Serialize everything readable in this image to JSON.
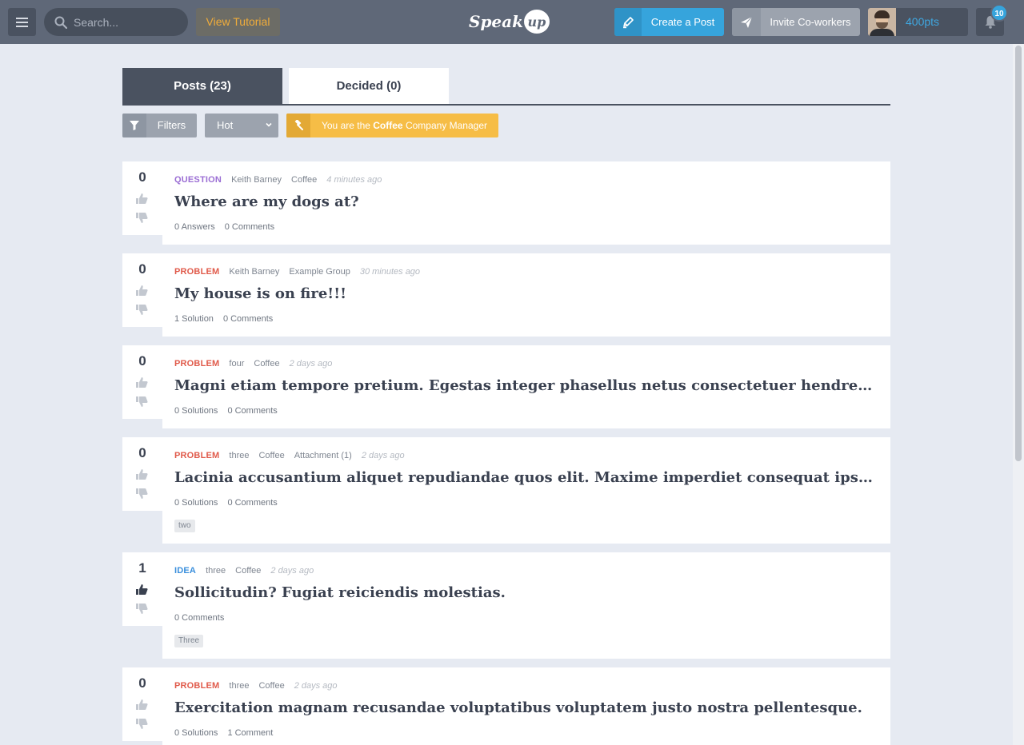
{
  "header": {
    "search_placeholder": "Search...",
    "tutorial_label": "View Tutorial",
    "logo_text": "Speak",
    "logo_bubble": "up",
    "create_label": "Create a Post",
    "invite_label": "Invite Co-workers",
    "points": "400pts",
    "notification_count": "10"
  },
  "tabs": {
    "posts": "Posts (23)",
    "decided": "Decided (0)"
  },
  "toolbar": {
    "filters_label": "Filters",
    "sort_value": "Hot",
    "manager_prefix": "You are the ",
    "manager_group": "Coffee",
    "manager_suffix": " Company Manager"
  },
  "colors": {
    "question": "#9b6ed4",
    "problem": "#e05a4a",
    "idea": "#3a8fdc"
  },
  "posts": [
    {
      "votes": "0",
      "type": "QUESTION",
      "author": "Keith Barney",
      "group": "Coffee",
      "attachment": "",
      "time": "4 minutes ago",
      "title": "Where are my dogs at?",
      "stat1": "0 Answers",
      "stat2": "0 Comments",
      "tag": ""
    },
    {
      "votes": "0",
      "type": "PROBLEM",
      "author": "Keith Barney",
      "group": "Example Group",
      "attachment": "",
      "time": "30 minutes ago",
      "title": "My house is on fire!!!",
      "stat1": "1 Solution",
      "stat2": "0 Comments",
      "tag": ""
    },
    {
      "votes": "0",
      "type": "PROBLEM",
      "author": "four",
      "group": "Coffee",
      "attachment": "",
      "time": "2 days ago",
      "title": "Magni etiam tempore pretium. Egestas integer phasellus netus consectetuer hendrerit convallis dictum lorem",
      "stat1": "0 Solutions",
      "stat2": "0 Comments",
      "tag": ""
    },
    {
      "votes": "0",
      "type": "PROBLEM",
      "author": "three",
      "group": "Coffee",
      "attachment": "Attachment (1)",
      "time": "2 days ago",
      "title": "Lacinia accusantium aliquet repudiandae quos elit. Maxime imperdiet consequat ipsam, aptent sapiente quis",
      "stat1": "0 Solutions",
      "stat2": "0 Comments",
      "tag": "two"
    },
    {
      "votes": "1",
      "type": "IDEA",
      "author": "three",
      "group": "Coffee",
      "attachment": "",
      "time": "2 days ago",
      "title": "Sollicitudin? Fugiat reiciendis molestias.",
      "stat1": "0 Comments",
      "stat2": "",
      "tag": "Three"
    },
    {
      "votes": "0",
      "type": "PROBLEM",
      "author": "three",
      "group": "Coffee",
      "attachment": "",
      "time": "2 days ago",
      "title": "Exercitation magnam recusandae voluptatibus voluptatem justo nostra pellentesque.",
      "stat1": "0 Solutions",
      "stat2": "1 Comment",
      "tag": ""
    }
  ]
}
